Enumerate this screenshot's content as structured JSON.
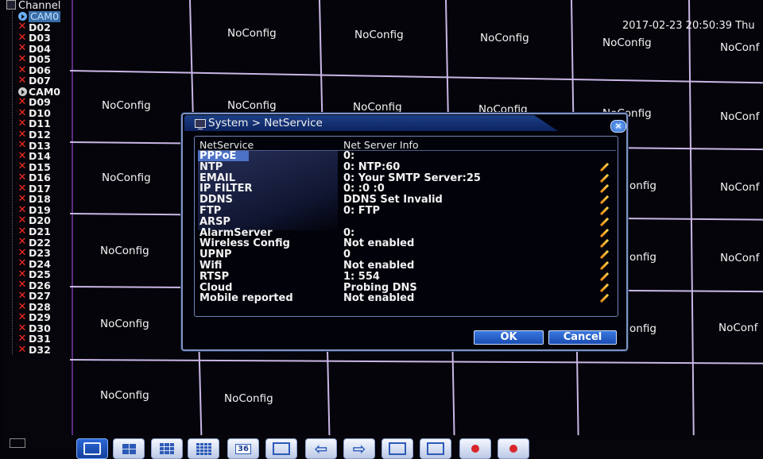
{
  "sidebar": {
    "title": "Channel",
    "channels": [
      {
        "label": "CAM0",
        "status": "play",
        "selected": true
      },
      {
        "label": "D02",
        "status": "x"
      },
      {
        "label": "D03",
        "status": "x"
      },
      {
        "label": "D04",
        "status": "x"
      },
      {
        "label": "D05",
        "status": "x"
      },
      {
        "label": "D06",
        "status": "x"
      },
      {
        "label": "D07",
        "status": "x"
      },
      {
        "label": "CAM0",
        "status": "play"
      },
      {
        "label": "D09",
        "status": "x"
      },
      {
        "label": "D10",
        "status": "x"
      },
      {
        "label": "D11",
        "status": "x"
      },
      {
        "label": "D12",
        "status": "x"
      },
      {
        "label": "D13",
        "status": "x"
      },
      {
        "label": "D14",
        "status": "x"
      },
      {
        "label": "D15",
        "status": "x"
      },
      {
        "label": "D16",
        "status": "x"
      },
      {
        "label": "D17",
        "status": "x"
      },
      {
        "label": "D18",
        "status": "x"
      },
      {
        "label": "D19",
        "status": "x"
      },
      {
        "label": "D20",
        "status": "x"
      },
      {
        "label": "D21",
        "status": "x"
      },
      {
        "label": "D22",
        "status": "x"
      },
      {
        "label": "D23",
        "status": "x"
      },
      {
        "label": "D24",
        "status": "x"
      },
      {
        "label": "D25",
        "status": "x"
      },
      {
        "label": "D26",
        "status": "x"
      },
      {
        "label": "D27",
        "status": "x"
      },
      {
        "label": "D28",
        "status": "x"
      },
      {
        "label": "D29",
        "status": "x"
      },
      {
        "label": "D30",
        "status": "x"
      },
      {
        "label": "D31",
        "status": "x"
      },
      {
        "label": "D32",
        "status": "x"
      }
    ]
  },
  "grid": {
    "cell_text": "NoConfig",
    "datetime": "2017-02-23 20:50:39 Thu",
    "truncated_cell_text": "NoConf",
    "truncated_behind_text": "onfig"
  },
  "dialog": {
    "title": "System > NetService",
    "close_glyph": "×",
    "header": {
      "service": "NetService",
      "info": "Net Server Info"
    },
    "rows": [
      {
        "service": "PPPoE",
        "info": "0:",
        "selected": true
      },
      {
        "service": "NTP",
        "info": "0: NTP:60"
      },
      {
        "service": "EMAIL",
        "info": "0: Your SMTP Server:25"
      },
      {
        "service": "IP FILTER",
        "info": "0: :0 :0"
      },
      {
        "service": "DDNS",
        "info": "DDNS Set Invalid"
      },
      {
        "service": "FTP",
        "info": "0: FTP"
      },
      {
        "service": "ARSP",
        "info": ""
      },
      {
        "service": "AlarmServer",
        "info": "0:"
      },
      {
        "service": "Wireless Config",
        "info": "Not enabled"
      },
      {
        "service": "UPNP",
        "info": "0"
      },
      {
        "service": "Wifi",
        "info": "Not enabled"
      },
      {
        "service": "RTSP",
        "info": "1: 554"
      },
      {
        "service": "Cloud",
        "info": "Probing DNS"
      },
      {
        "service": "Mobile reported",
        "info": "Not enabled"
      }
    ],
    "ok_label": "OK",
    "cancel_label": "Cancel"
  },
  "toolbar": {
    "buttons": [
      {
        "name": "layout-1-button",
        "icon": "single-view-icon",
        "active": true
      },
      {
        "name": "layout-4-button",
        "icon": "quad-view-icon"
      },
      {
        "name": "layout-8-button",
        "icon": "eight-view-icon"
      },
      {
        "name": "layout-16-button",
        "icon": "sixteen-view-icon"
      },
      {
        "name": "layout-36-button",
        "icon": "thirty-six-view-icon",
        "text": "36"
      },
      {
        "name": "fullscreen-button",
        "icon": "fullscreen-icon"
      },
      {
        "name": "previous-button",
        "icon": "arrow-left-icon"
      },
      {
        "name": "next-button",
        "icon": "arrow-right-icon"
      },
      {
        "name": "playback-button",
        "icon": "playback-icon"
      },
      {
        "name": "monitor-button",
        "icon": "monitor-icon"
      },
      {
        "name": "record-button",
        "icon": "record-icon"
      },
      {
        "name": "record-config-button",
        "icon": "record-config-icon"
      }
    ]
  },
  "colors": {
    "grid_line": "#c9b6e6",
    "dialog_border": "#7d94c4",
    "selection": "#4c72c6",
    "error_x": "#ff2a1e",
    "button_blue": "#2b67d8"
  }
}
